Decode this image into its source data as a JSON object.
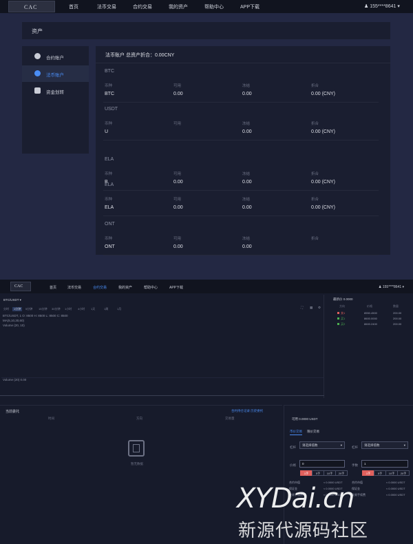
{
  "nav": {
    "logo_text": "CAC",
    "items": [
      "首页",
      "法币交易",
      "合约交易",
      "我的资产",
      "帮助中心",
      "APP下载"
    ],
    "user": "155****8641"
  },
  "assets": {
    "header_title": "资产",
    "menu": [
      "合约账户",
      "法币账户",
      "资金划转"
    ],
    "panel_title": "法币账户 总资产折合：0.00CNY",
    "columns": [
      "币种",
      "可用",
      "冻结",
      "折合"
    ],
    "coins": [
      {
        "name": "BTC",
        "symbol": "BTC",
        "available": "0.00",
        "frozen": "0.00",
        "value": "0.00 (CNY)"
      },
      {
        "name": "USDT",
        "symbol": "U",
        "available": "",
        "frozen": "0.00",
        "value": "0.00 (CNY)"
      },
      {
        "name": "ELA",
        "symbol": "B",
        "available": "0.00",
        "frozen": "0.00",
        "value": "0.00 (CNY)"
      },
      {
        "name": "ELA",
        "symbol": "ELA",
        "available": "0.00",
        "frozen": "0.00",
        "value": "0.00 (CNY)"
      },
      {
        "name": "ONT",
        "symbol": "ONT",
        "available": "0.00",
        "frozen": "0.00",
        "value": ""
      }
    ]
  },
  "nav2": {
    "logo_text": "CAC",
    "items": [
      "首页",
      "法币交易",
      "合约交易",
      "我的资产",
      "帮助中心",
      "APP下载"
    ],
    "active": "合约交易",
    "user": "155****8641"
  },
  "trade": {
    "pair": "BTC/USDT",
    "chart_tabs": [
      "分时",
      "1分钟",
      "5分钟",
      "15分钟",
      "30分钟",
      "1小时",
      "4小时",
      "1天",
      "1周",
      "1月"
    ],
    "chart_active_tab": "1分钟",
    "chart_info_1": "BTC/USDT, 1  O: 8500  H: 8500  L: 8500  C: 8500",
    "chart_info_2": "MA(5,10,30,60)",
    "chart_info_3": "Volume (20, 10)",
    "chart_volume_label": "Volume (20)  0.00",
    "orderbook_title": "最新价 0.0000",
    "orderbook_cols": [
      "方向",
      "价格",
      "数量"
    ],
    "orderbook_rows": [
      {
        "side": "卖1",
        "price": "8550.4500",
        "qty": "200.00",
        "color": "#e0605d"
      },
      {
        "side": "买1",
        "price": "8600.0000",
        "qty": "200.00",
        "color": "#4caf50"
      },
      {
        "side": "买2",
        "price": "8600.2400",
        "qty": "200.00",
        "color": "#4caf50"
      }
    ],
    "entrust_title": "当前委托",
    "entrust_links": "合约持仓记录   历史委托",
    "entrust_cols": [
      "时间",
      "方向",
      "交易量"
    ],
    "empty_text": "暂无数据",
    "available": "可用 0.0000 USDT",
    "order_tabs": [
      "市价交易",
      "限价交易"
    ],
    "buy_leverage_label": "杠杆",
    "buy_leverage_placeholder": "请选择倍数",
    "sell_leverage_label": "杠杆",
    "sell_leverage_placeholder": "请选择倍数",
    "buy_price_label": "价格",
    "buy_price_value": "0",
    "sell_price_label": "手数",
    "sell_qty_value": "1",
    "quick_buttons": [
      "1手",
      "5手",
      "10手",
      "20手"
    ],
    "info_rows": [
      [
        "合约市值",
        "≈ 0.0000 USDT",
        "合约市值",
        "≈ 0.0000 USDT"
      ],
      [
        "保证金",
        "≈ 0.0000 USDT",
        "保证金",
        "≈ 0.0000 USDT"
      ],
      [
        "交易手续费",
        "≈ 0.0000 USDT",
        "交易手续费",
        "≈ 0.0000 USDT"
      ]
    ]
  },
  "watermark": {
    "line1": "XYDai.cn",
    "line2": "新源代源码社区"
  }
}
